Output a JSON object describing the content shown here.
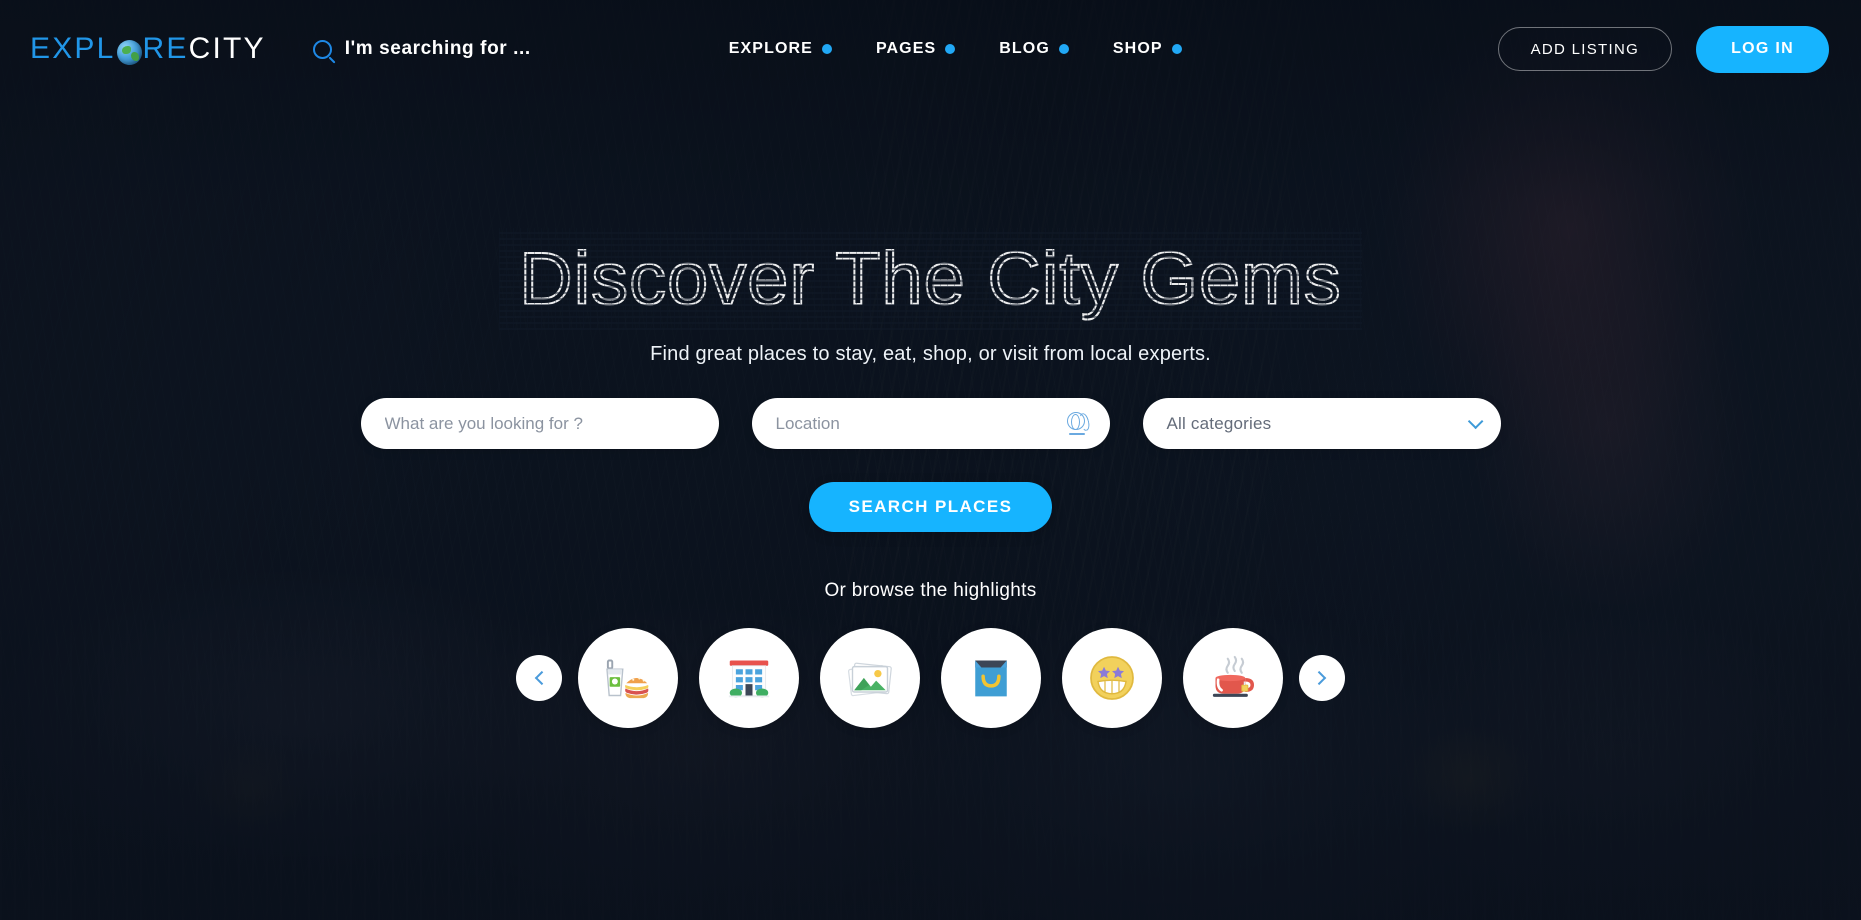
{
  "header": {
    "logo": {
      "part1": "EXPL",
      "globe_icon": "globe-icon",
      "part2": "RE",
      "part3": "CITY"
    },
    "search_prompt": "I'm searching for ...",
    "search_icon": "search-icon",
    "nav": [
      {
        "label": "EXPLORE",
        "dot_icon": "blue-dot-icon"
      },
      {
        "label": "PAGES",
        "dot_icon": "blue-dot-icon"
      },
      {
        "label": "BLOG",
        "dot_icon": "blue-dot-icon"
      },
      {
        "label": "SHOP",
        "dot_icon": "blue-dot-icon"
      }
    ],
    "add_listing_label": "ADD LISTING",
    "login_label": "LOG IN"
  },
  "hero": {
    "title": "Discover The City Gems",
    "subtitle": "Find great places to stay, eat, shop, or visit from local experts.",
    "search": {
      "keyword_placeholder": "What are you looking for ?",
      "keyword_value": "",
      "location_placeholder": "Location",
      "location_value": "",
      "location_icon": "globe-locate-icon",
      "category_selected": "All categories",
      "category_chevron_icon": "chevron-down-icon",
      "submit_label": "SEARCH PLACES"
    },
    "browse_label": "Or browse the highlights",
    "carousel": {
      "prev_icon": "chevron-left-icon",
      "next_icon": "chevron-right-icon",
      "categories": [
        {
          "name": "food-and-drink",
          "icon": "burger-and-soda-icon"
        },
        {
          "name": "hotels",
          "icon": "building-icon"
        },
        {
          "name": "photos",
          "icon": "photo-stack-icon"
        },
        {
          "name": "shopping",
          "icon": "shopping-bag-icon"
        },
        {
          "name": "entertainment",
          "icon": "star-eyes-smiley-icon"
        },
        {
          "name": "cafes",
          "icon": "coffee-cup-icon"
        }
      ]
    }
  },
  "colors": {
    "accent_blue": "#16b4ff",
    "logo_blue": "#2196e8",
    "nav_dot": "#21a8f5",
    "hero_bg_dark": "#101b2b",
    "field_white": "#ffffff"
  }
}
